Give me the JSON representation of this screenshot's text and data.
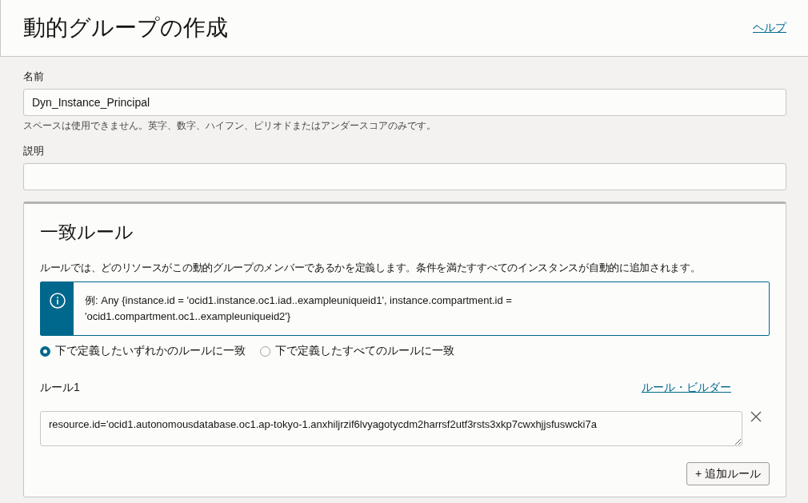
{
  "header": {
    "title": "動的グループの作成",
    "help_link": "ヘルプ"
  },
  "name_field": {
    "label": "名前",
    "value": "Dyn_Instance_Principal",
    "hint": "スペースは使用できません。英字、数字、ハイフン、ピリオドまたはアンダースコアのみです。"
  },
  "description_field": {
    "label": "説明"
  },
  "matching_rules": {
    "title": "一致ルール",
    "description": "ルールでは、どのリソースがこの動的グループのメンバーであるかを定義します。条件を満たすすべてのインスタンスが自動的に追加されます。",
    "info": "例: Any {instance.id = 'ocid1.instance.oc1.iad..exampleuniqueid1', instance.compartment.id = 'ocid1.compartment.oc1..exampleuniqueid2'}",
    "match_options": [
      {
        "label": "下で定義したいずれかのルールに一致",
        "selected": true
      },
      {
        "label": "下で定義したすべてのルールに一致",
        "selected": false
      }
    ],
    "rules": [
      {
        "label": "ルール1",
        "builder_link": "ルール・ビルダー",
        "value": "resource.id='ocid1.autonomousdatabase.oc1.ap-tokyo-1.anxhiljrzif6lvyagotycdm2harrsf2utf3rsts3xkp7cwxhjjsfuswcki7a"
      }
    ],
    "add_button": "+ 追加ルール"
  }
}
